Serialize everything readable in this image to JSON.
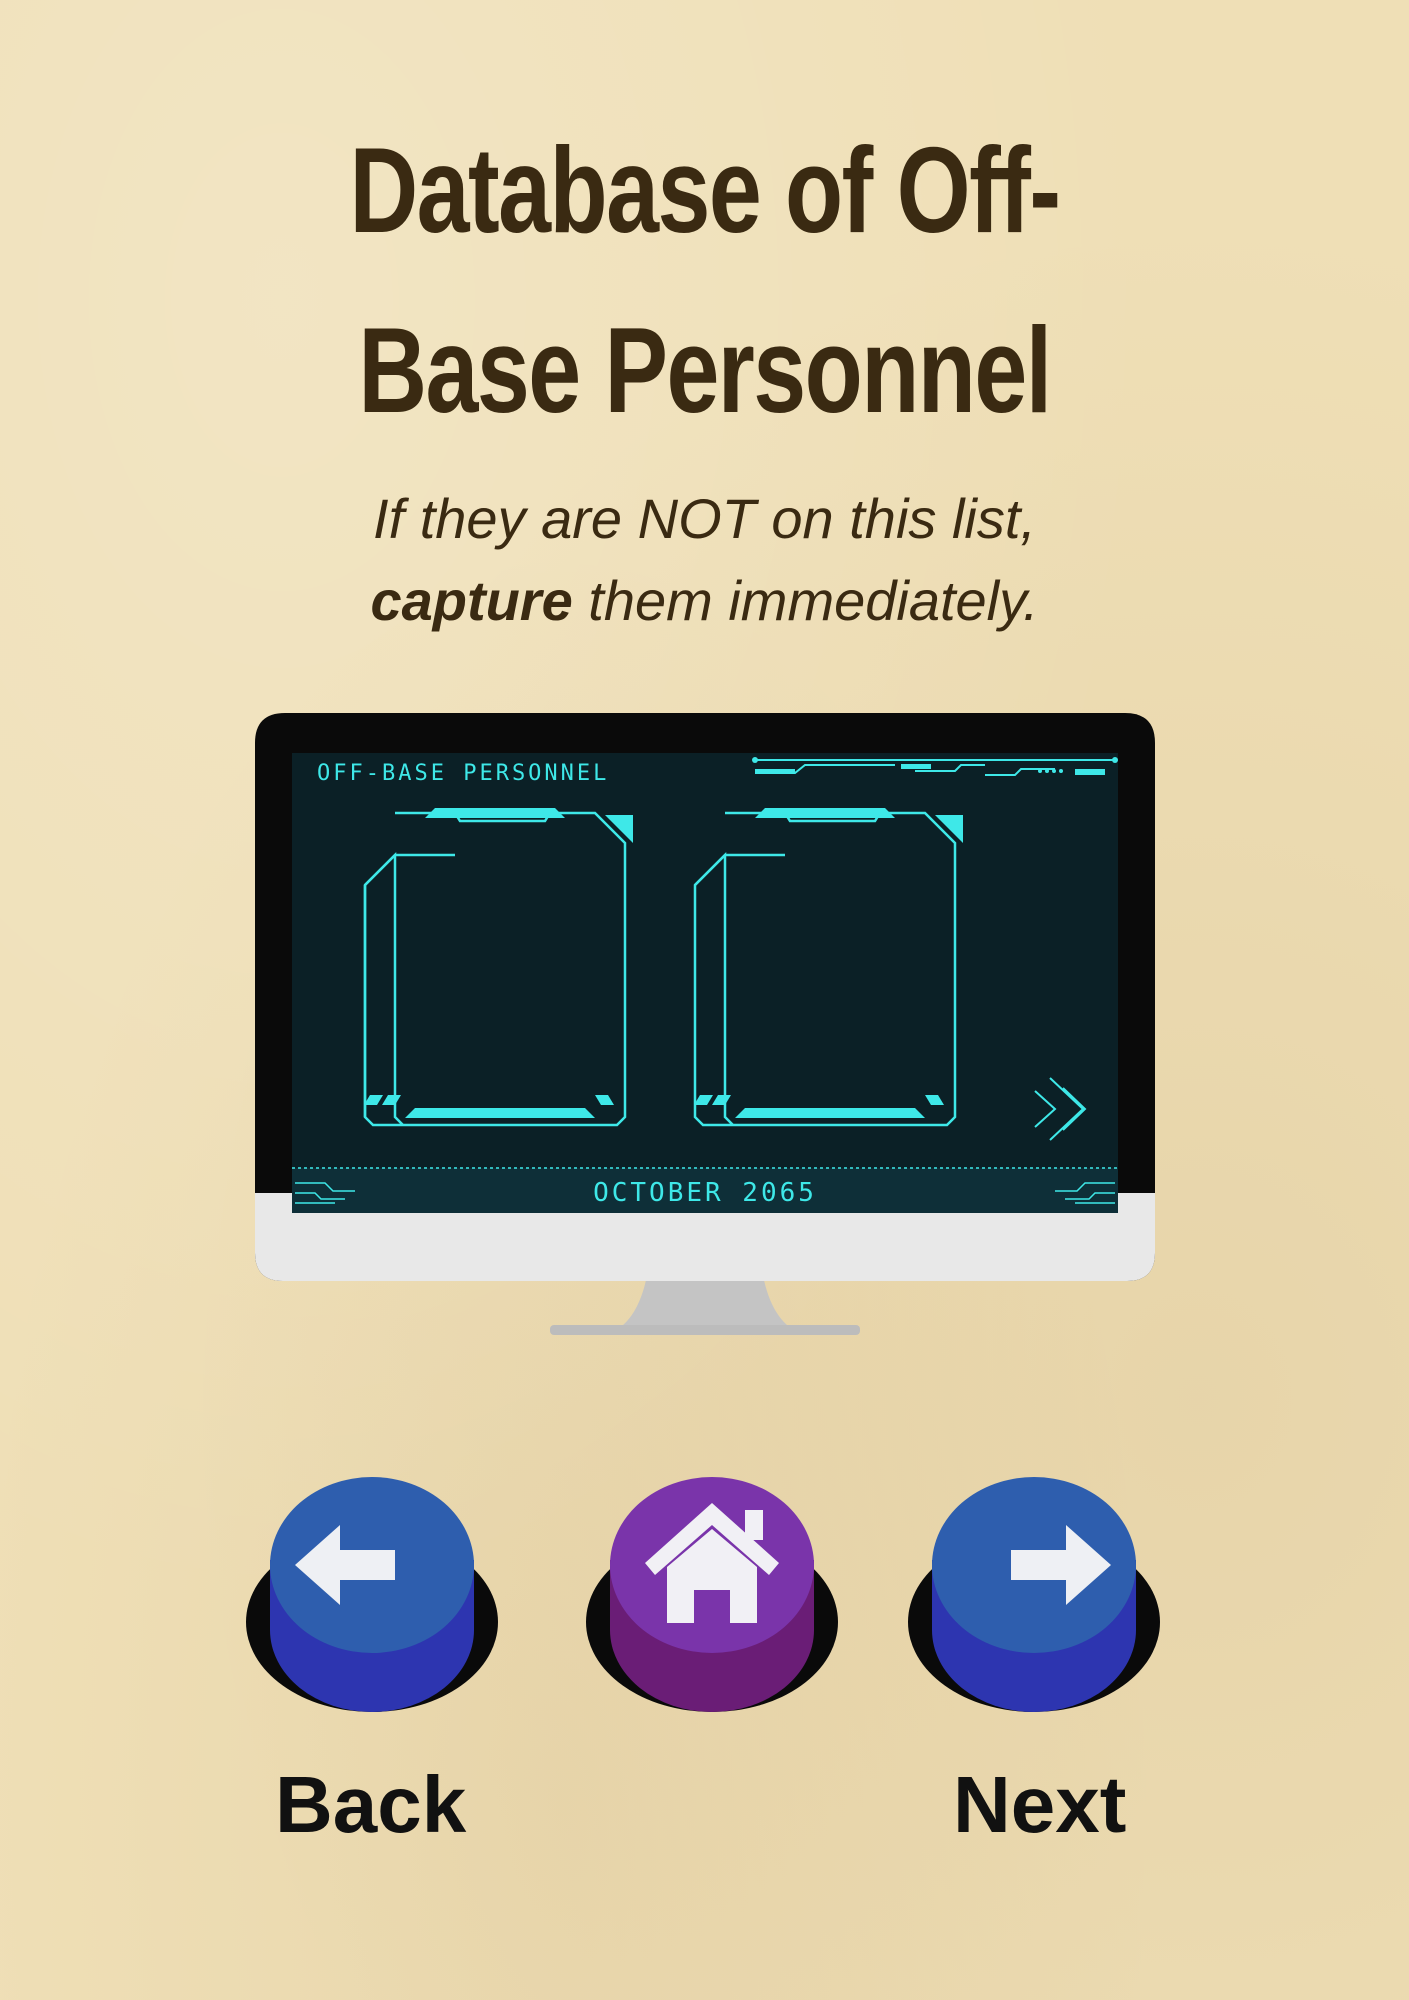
{
  "page": {
    "title_line1": "Database of Off-",
    "title_line2": "Base Personnel",
    "subtitle_line1": "If they are NOT on this list,",
    "subtitle_bold": "capture",
    "subtitle_rest": " them immediately."
  },
  "screen": {
    "header": "OFF-BASE PERSONNEL",
    "footer": "OCTOBER 2065",
    "frame_color": "#3ee8e8",
    "background": "#0a2026"
  },
  "buttons": {
    "back_label": "Back",
    "next_label": "Next",
    "back_icon": "arrow-left-icon",
    "home_icon": "home-icon",
    "next_icon": "arrow-right-icon"
  },
  "colors": {
    "page_bg": "#efdfb6",
    "title": "#3a2a12",
    "blue_button": "#2e5eae",
    "purple_button": "#7a34aa"
  }
}
